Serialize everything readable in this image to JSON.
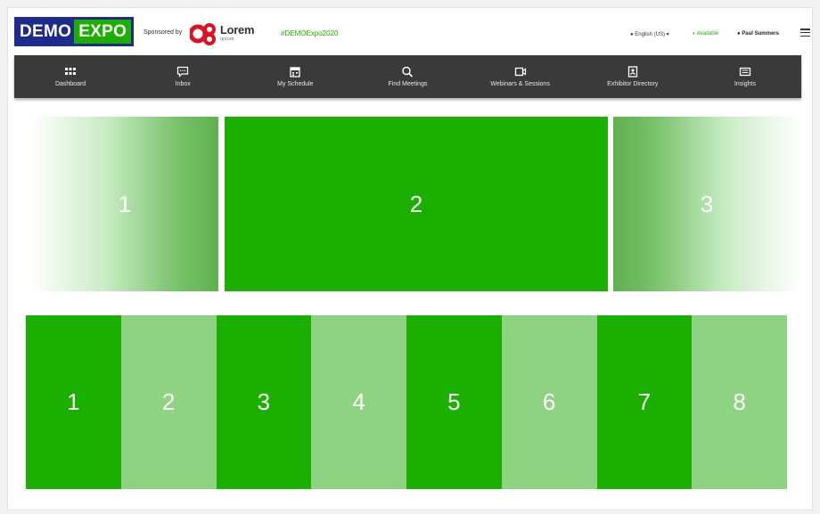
{
  "header": {
    "logo_left": "DEMO",
    "logo_right": "EXPO",
    "sponsored_by": "Sponsored by",
    "sponsor_name": "Lorem",
    "sponsor_sub": "ipsum",
    "hashtag": "#DEMOExpo2020",
    "language": "English (US) ▾",
    "status": "Available",
    "user": "Paul Summers"
  },
  "nav": {
    "items": [
      {
        "label": "Dashboard",
        "icon": "grid-icon"
      },
      {
        "label": "Inbox",
        "icon": "chat-icon"
      },
      {
        "label": "My Schedule",
        "icon": "calendar-icon"
      },
      {
        "label": "Find Meetings",
        "icon": "search-icon"
      },
      {
        "label": "Webinars & Sessions",
        "icon": "video-icon"
      },
      {
        "label": "Exhibitor Directory",
        "icon": "contact-icon"
      },
      {
        "label": "Insights",
        "icon": "insights-icon"
      }
    ]
  },
  "carousel": {
    "slides": [
      "1",
      "2",
      "3"
    ]
  },
  "tiles": [
    "1",
    "2",
    "3",
    "4",
    "5",
    "6",
    "7",
    "8"
  ],
  "colors": {
    "brand_green": "#1bb000",
    "light_green": "#8dd381",
    "nav_bg": "#3a3a3a",
    "logo_blue": "#1e2a8c"
  }
}
